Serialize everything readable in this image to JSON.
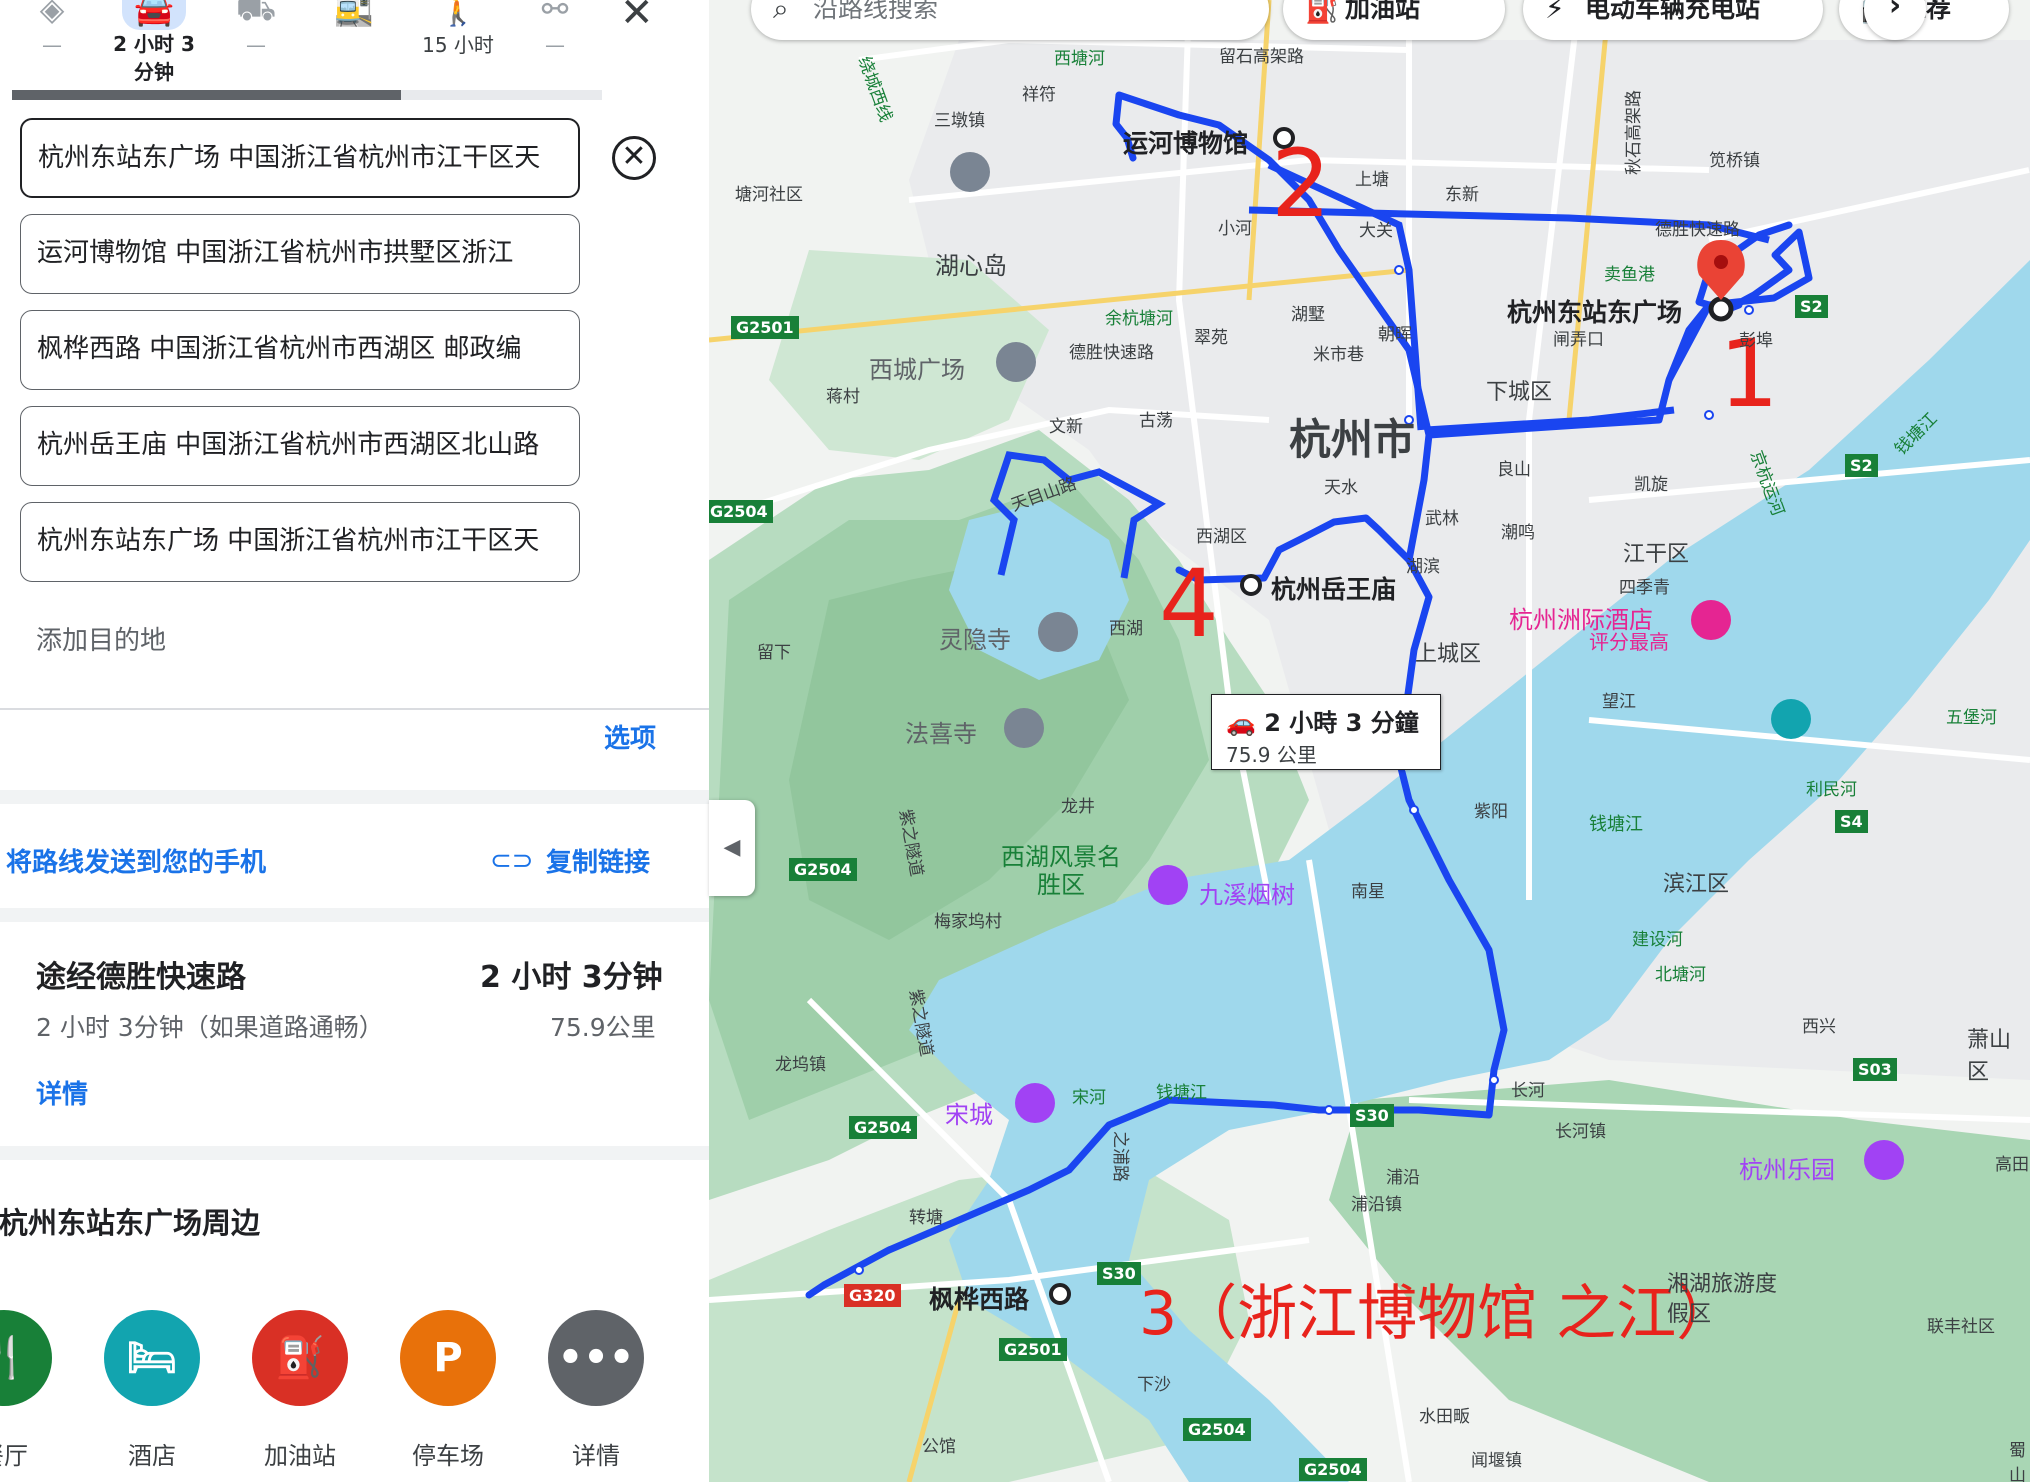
{
  "travel_modes": [
    {
      "label": "—",
      "icon": "directions-icon",
      "active": false
    },
    {
      "label": "2 小时 3 分钟",
      "icon": "car-icon",
      "active": true
    },
    {
      "label": "—",
      "icon": "motorcycle-icon",
      "active": false
    },
    {
      "label": "",
      "icon": "transit-icon",
      "active": false
    },
    {
      "label": "15 小时",
      "icon": "walk-icon",
      "active": false
    },
    {
      "label": "—",
      "icon": "bike-icon",
      "active": false
    }
  ],
  "mode_car_line1": "2 小时 3",
  "mode_car_line2": "分钟",
  "waypoints": [
    "杭州东站东广场 中国浙江省杭州市江干区天",
    "运河博物馆 中国浙江省杭州市拱墅区浙江",
    "枫桦西路 中国浙江省杭州市西湖区 邮政编",
    "杭州岳王庙 中国浙江省杭州市西湖区北山路",
    "杭州东站东广场 中国浙江省杭州市江干区天"
  ],
  "add_destination": "添加目的地",
  "options": "选项",
  "send_to_phone": "将路线发送到您的手机",
  "copy_link": "复制链接",
  "route": {
    "via": "途经德胜快速路",
    "time": "2 小时 3分钟",
    "traffic": "2 小时 3分钟（如果道路通畅）",
    "distance": "75.9公里",
    "details": "详情"
  },
  "nearby_title": "在杭州东站东广场周边",
  "nearby": [
    {
      "label": "餐厅",
      "color": "#188038",
      "icon": "restaurant-icon"
    },
    {
      "label": "酒店",
      "color": "#12a4af",
      "icon": "hotel-icon"
    },
    {
      "label": "加油站",
      "color": "#d93025",
      "icon": "gas-station-icon"
    },
    {
      "label": "停车场",
      "color": "#e8710a",
      "icon": "parking-icon"
    },
    {
      "label": "详情",
      "color": "#5f6368",
      "icon": "more-icon"
    }
  ],
  "map": {
    "search_placeholder": "沿路线搜索",
    "chips": [
      "加油站",
      "电动车辆充电站",
      "推荐"
    ],
    "info_time": "2 小時 3 分鐘",
    "info_distance": "75.9 公里",
    "route_color": "#1a45f0",
    "annotation_color": "#e8231c",
    "markers": [
      {
        "name": "杭州东站东广场",
        "number": "1"
      },
      {
        "name": "运河博物馆",
        "number": "2"
      },
      {
        "name": "枫桦西路",
        "number": "3（浙江博物馆 之江）"
      },
      {
        "name": "杭州岳王庙",
        "number": "4"
      }
    ],
    "city_label": "杭州市",
    "districts": [
      "下城区",
      "江干区",
      "上城区",
      "滨江区",
      "西湖区"
    ],
    "pois": [
      "灵隐寺",
      "法喜寺",
      "九溪烟树",
      "西湖风景名胜区",
      "宋城",
      "杭州乐园",
      "杭州洲际酒店",
      "评分最高",
      "西城广场",
      "湖心岛",
      "湘湖旅游度假区"
    ],
    "places": [
      "西塘河",
      "留石高架路",
      "祥符",
      "三墩镇",
      "塘河社区",
      "上塘",
      "东新",
      "笕桥镇",
      "小河",
      "大关",
      "德胜快速路",
      "德胜快速路",
      "卖鱼港",
      "闸弄口",
      "彭埠",
      "余杭塘河",
      "翠苑",
      "湖墅",
      "朝晖",
      "米市巷",
      "蒋村",
      "文新",
      "古荡",
      "良山",
      "凯旋",
      "天水",
      "武林",
      "潮鸣",
      "天目山路",
      "湖滨",
      "四季青",
      "西湖",
      "留下",
      "望江",
      "紫阳",
      "钱塘江",
      "五堡河",
      "利民河",
      "龙井",
      "梅家坞村",
      "南星",
      "建设河",
      "北塘河",
      "西兴",
      "萧山区",
      "龙坞镇",
      "宋河",
      "钱塘江",
      "长河",
      "长河镇",
      "浦沿",
      "浦沿镇",
      "转塘",
      "之浦路",
      "下沙",
      "水田畈",
      "公馆",
      "闻堰镇",
      "联丰社区",
      "高田",
      "京杭运河",
      "秋石高架路",
      "钱塘江",
      "蜀山",
      "紫之隧道",
      "紫之隧道",
      "绕城西线"
    ],
    "roads": [
      "G2501",
      "G2504",
      "G2504",
      "G2504",
      "G2501",
      "G2504",
      "G320",
      "S30",
      "S30",
      "S2",
      "S2",
      "S4",
      "S03",
      "G2504"
    ]
  }
}
